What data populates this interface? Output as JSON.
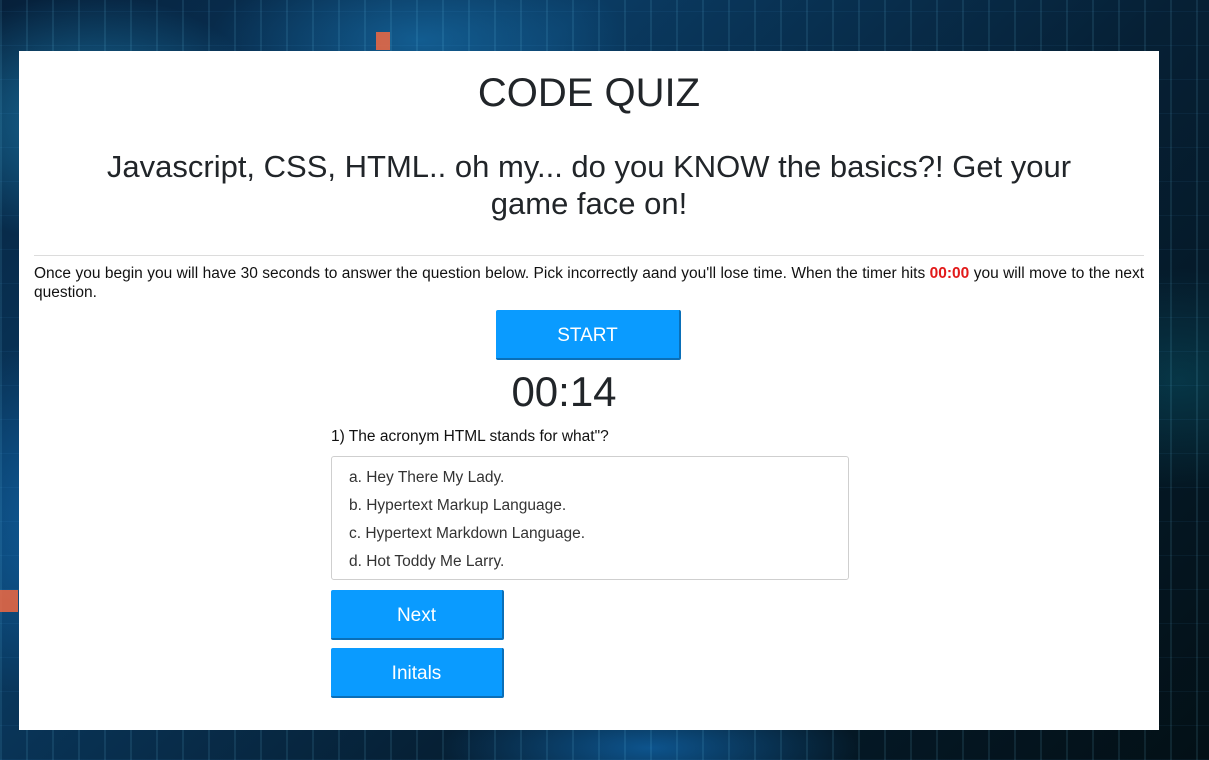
{
  "page": {
    "title": "CODE QUIZ",
    "subtitle": "Javascript, CSS, HTML.. oh my... do you KNOW the basics?! Get your game face on!"
  },
  "instructions": {
    "before": "Once you begin you will have 30 seconds to answer the question below. Pick incorrectly aand you'll lose time. When the timer hits ",
    "timer_zero": "00:00",
    "after": " you will move to the next question."
  },
  "controls": {
    "start_label": "START",
    "next_label": "Next",
    "initials_label": "Initals"
  },
  "timer": {
    "display": "00:14"
  },
  "quiz": {
    "question": "1) The acronym HTML stands for what\"?",
    "answers": [
      "a. Hey There My Lady.",
      "b. Hypertext Markup Language.",
      "c. Hypertext Markdown Language.",
      "d. Hot Toddy Me Larry."
    ]
  },
  "colors": {
    "button_blue": "#0a9bff",
    "timer_red": "#e21a1a",
    "card_bg": "#ffffff"
  }
}
